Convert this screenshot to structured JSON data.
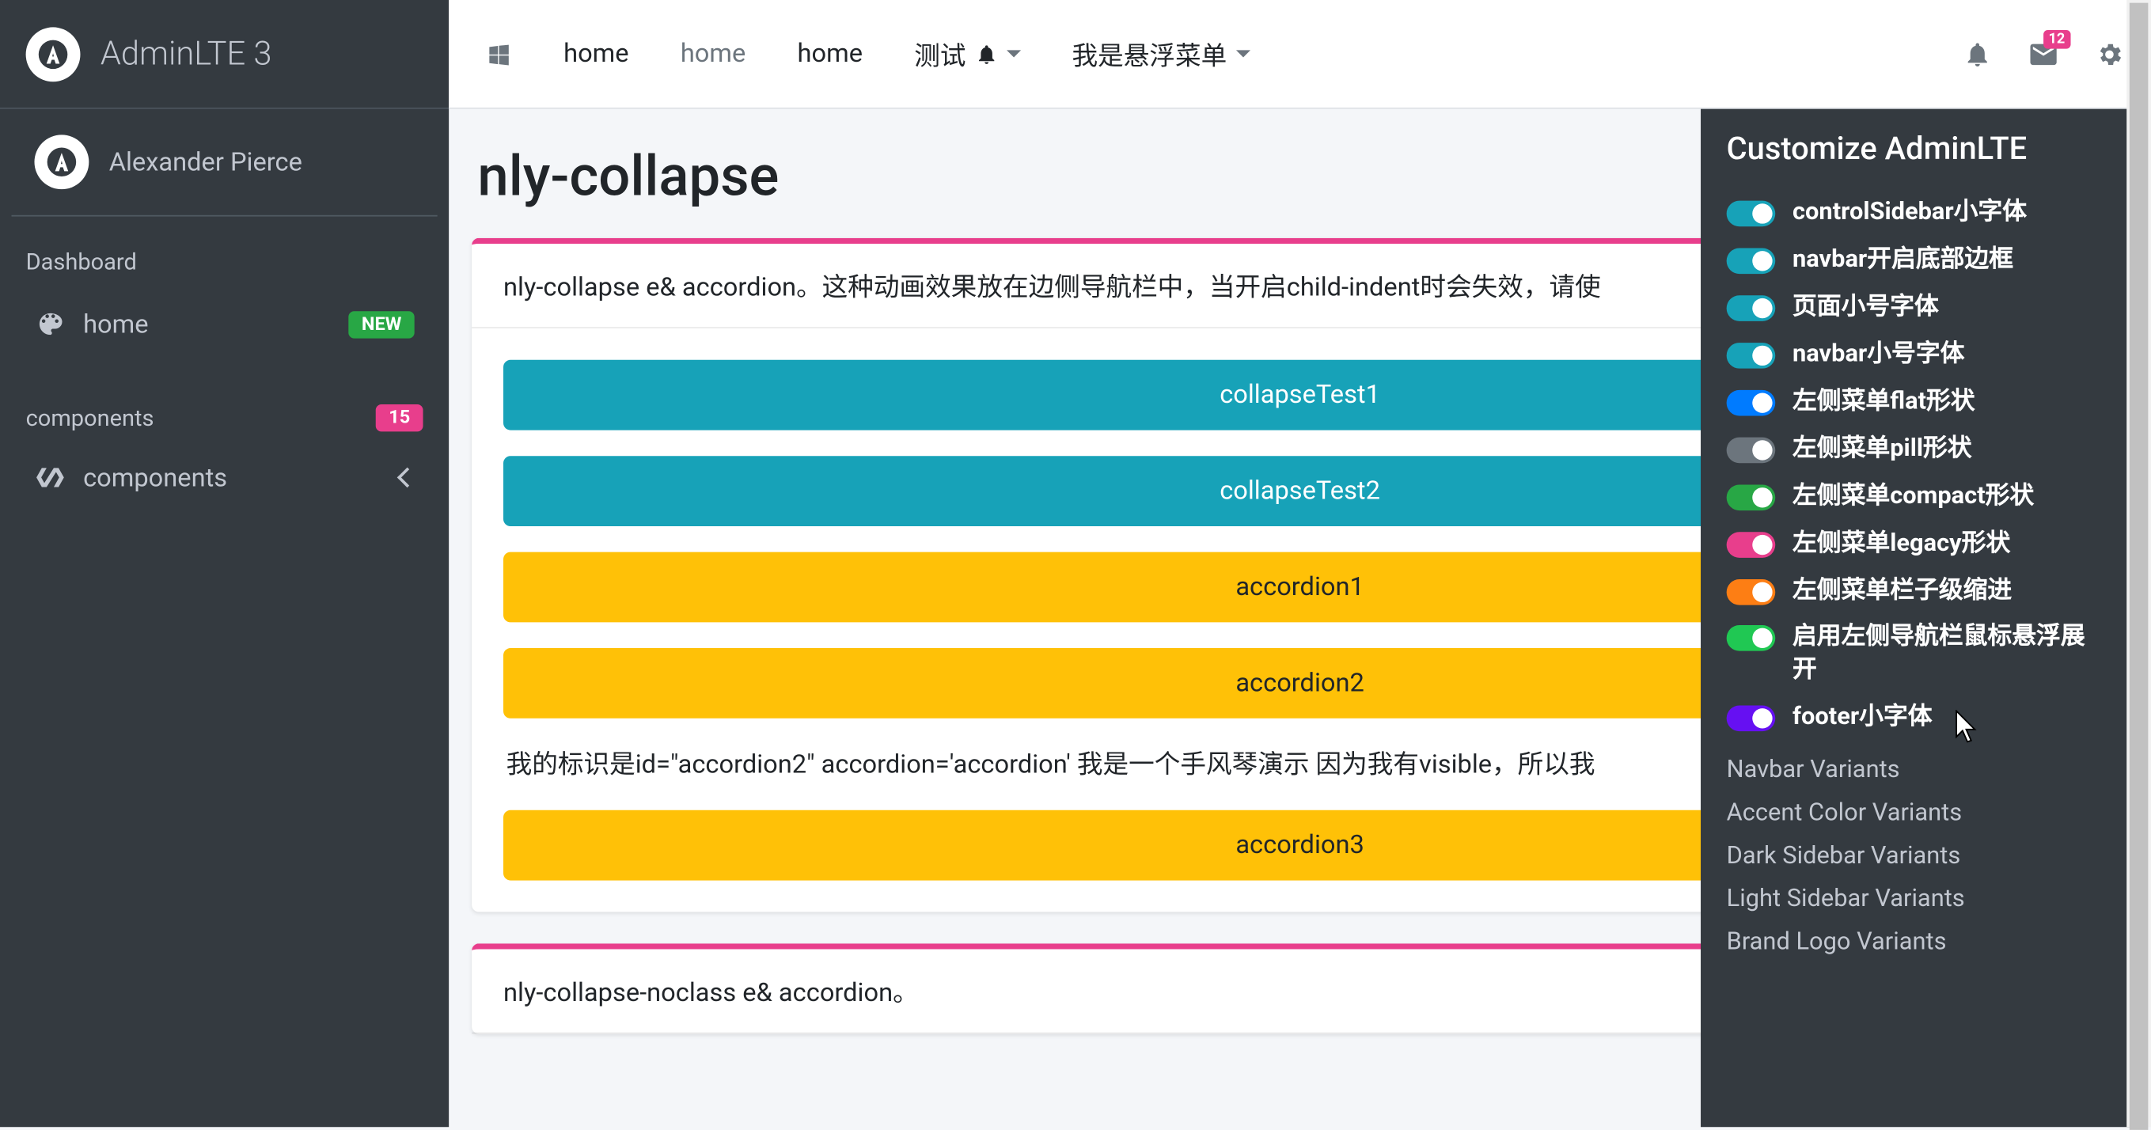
{
  "brand": {
    "text": "AdminLTE 3"
  },
  "user": {
    "name": "Alexander Pierce"
  },
  "sidebar": {
    "section1": {
      "header": "Dashboard"
    },
    "home": {
      "label": "home",
      "badge": "NEW"
    },
    "section2": {
      "header": "components",
      "badge": "15"
    },
    "components": {
      "label": "components"
    }
  },
  "navbar": {
    "items": [
      "home",
      "home",
      "home",
      "测试",
      "我是悬浮菜单"
    ],
    "mailBadge": "12"
  },
  "page": {
    "title": "nly-collapse"
  },
  "card1": {
    "header": "nly-collapse e& accordion。这种动画效果放在边侧导航栏中，当开启child-indent时会失效，请使",
    "items": {
      "collapse1": "collapseTest1",
      "collapse2": "collapseTest2",
      "accordion1": "accordion1",
      "accordion2": "accordion2",
      "accordion2Content": "我的标识是id=\"accordion2\" accordion='accordion' 我是一个手风琴演示 因为我有visible，所以我",
      "accordion3": "accordion3"
    }
  },
  "card2": {
    "header": "nly-collapse-noclass e& accordion。"
  },
  "controlSidebar": {
    "title": "Customize AdminLTE",
    "toggles": [
      {
        "label": "controlSidebar小字体",
        "color": "#17a2b8",
        "on": true
      },
      {
        "label": "navbar开启底部边框",
        "color": "#17a2b8",
        "on": true
      },
      {
        "label": "页面小号字体",
        "color": "#17a2b8",
        "on": true
      },
      {
        "label": "navbar小号字体",
        "color": "#17a2b8",
        "on": true
      },
      {
        "label": "左侧菜单flat形状",
        "color": "#007bff",
        "on": true
      },
      {
        "label": "左侧菜单pill形状",
        "color": "#6c757d",
        "on": true
      },
      {
        "label": "左侧菜单compact形状",
        "color": "#28a745",
        "on": true
      },
      {
        "label": "左侧菜单legacy形状",
        "color": "#e83e8c",
        "on": true
      },
      {
        "label": "左侧菜单栏子级缩进",
        "color": "#fd7e14",
        "on": true
      },
      {
        "label": "启用左侧导航栏鼠标悬浮展开",
        "color": "#20c853",
        "on": true
      },
      {
        "label": "footer小字体",
        "color": "#6610f2",
        "on": true
      }
    ],
    "variants": [
      "Navbar Variants",
      "Accent Color Variants",
      "Dark Sidebar Variants",
      "Light Sidebar Variants",
      "Brand Logo Variants"
    ]
  }
}
